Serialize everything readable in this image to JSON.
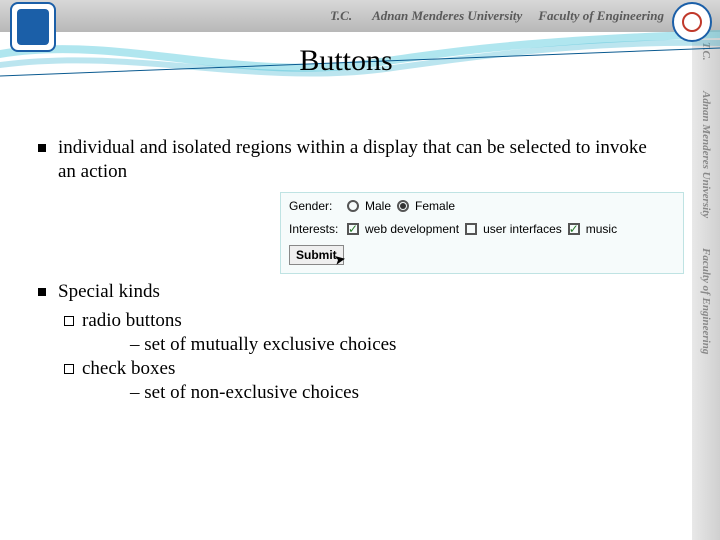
{
  "header": {
    "tc": "T.C.",
    "university": "Adnan Menderes University",
    "faculty": "Faculty of Engineering"
  },
  "sidebar": {
    "tc": "T.C.",
    "university": "Adnan Menderes University",
    "faculty": "Faculty of Engineering"
  },
  "title": "Buttons",
  "bullets": {
    "b1": "individual and isolated regions within a display that can be selected to invoke an action",
    "b2": "Special kinds",
    "sub_radio": "radio buttons",
    "sub_radio_desc": "– set of mutually exclusive choices",
    "sub_check": "check boxes",
    "sub_check_desc": "– set of non-exclusive choices"
  },
  "form": {
    "gender_label": "Gender:",
    "male": "Male",
    "female": "Female",
    "interests_label": "Interests:",
    "opt_web": "web development",
    "opt_ui": "user interfaces",
    "opt_music": "music",
    "submit": "Submit"
  }
}
